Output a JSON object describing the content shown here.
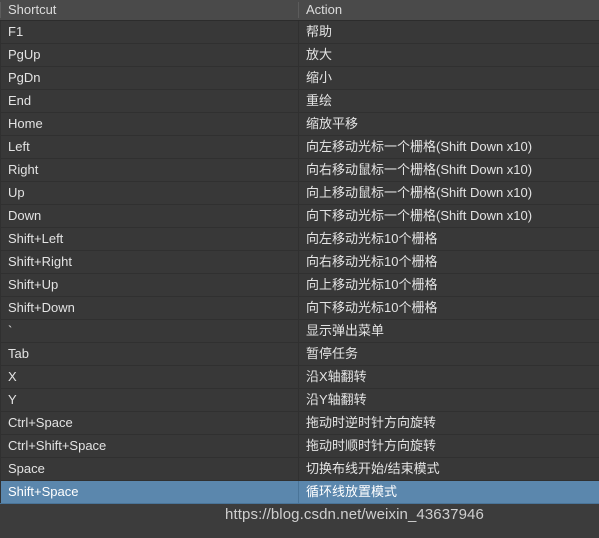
{
  "table": {
    "columns": [
      {
        "key": "shortcut",
        "label": "Shortcut"
      },
      {
        "key": "action",
        "label": "Action"
      }
    ],
    "rows": [
      {
        "shortcut": "F1",
        "action": "帮助",
        "selected": false
      },
      {
        "shortcut": "PgUp",
        "action": "放大",
        "selected": false
      },
      {
        "shortcut": "PgDn",
        "action": "缩小",
        "selected": false
      },
      {
        "shortcut": "End",
        "action": "重绘",
        "selected": false
      },
      {
        "shortcut": "Home",
        "action": "缩放平移",
        "selected": false
      },
      {
        "shortcut": "Left",
        "action": "向左移动光标一个栅格(Shift Down x10)",
        "selected": false
      },
      {
        "shortcut": "Right",
        "action": "向右移动鼠标一个栅格(Shift Down x10)",
        "selected": false
      },
      {
        "shortcut": "Up",
        "action": "向上移动鼠标一个栅格(Shift Down x10)",
        "selected": false
      },
      {
        "shortcut": "Down",
        "action": "向下移动光标一个栅格(Shift Down x10)",
        "selected": false
      },
      {
        "shortcut": "Shift+Left",
        "action": "向左移动光标10个栅格",
        "selected": false
      },
      {
        "shortcut": "Shift+Right",
        "action": "向右移动光标10个栅格",
        "selected": false
      },
      {
        "shortcut": "Shift+Up",
        "action": "向上移动光标10个栅格",
        "selected": false
      },
      {
        "shortcut": "Shift+Down",
        "action": "向下移动光标10个栅格",
        "selected": false
      },
      {
        "shortcut": "`",
        "action": "显示弹出菜单",
        "selected": false
      },
      {
        "shortcut": "Tab",
        "action": "暂停任务",
        "selected": false
      },
      {
        "shortcut": "X",
        "action": "沿X轴翻转",
        "selected": false
      },
      {
        "shortcut": "Y",
        "action": "沿Y轴翻转",
        "selected": false
      },
      {
        "shortcut": "Ctrl+Space",
        "action": "拖动时逆时针方向旋转",
        "selected": false
      },
      {
        "shortcut": "Ctrl+Shift+Space",
        "action": "拖动时顺时针方向旋转",
        "selected": false
      },
      {
        "shortcut": "Space",
        "action": "切换布线开始/结束模式",
        "selected": false
      },
      {
        "shortcut": "Shift+Space",
        "action": "循环线放置模式",
        "selected": true
      }
    ]
  },
  "watermark": {
    "text": "https://blog.csdn.net/weixin_43637946"
  },
  "colors": {
    "header_background": "#4a4a4a",
    "row_background": "#383838",
    "panel_background": "#3c3c3c",
    "selection_background": "#5b87ad",
    "text": "#e3e3e3",
    "separator": "#303030"
  }
}
